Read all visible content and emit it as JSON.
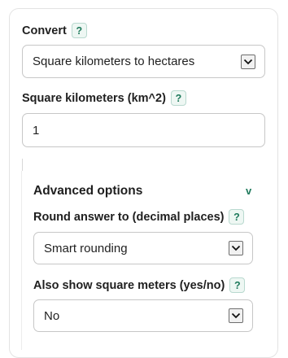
{
  "convert": {
    "label": "Convert",
    "help": "?",
    "selected": "Square kilometers to hectares"
  },
  "input": {
    "label": "Square kilometers (km^2)",
    "help": "?",
    "value": "1"
  },
  "advanced": {
    "title": "Advanced options",
    "toggle": "v",
    "round": {
      "label": "Round answer to (decimal places)",
      "help": "?",
      "selected": "Smart rounding"
    },
    "show_sqm": {
      "label": "Also show square meters (yes/no)",
      "help": "?",
      "selected": "No"
    }
  },
  "colors": {
    "accent": "#1f7a5c",
    "help_bg": "#eef7f3",
    "border": "#c7c7c7"
  }
}
